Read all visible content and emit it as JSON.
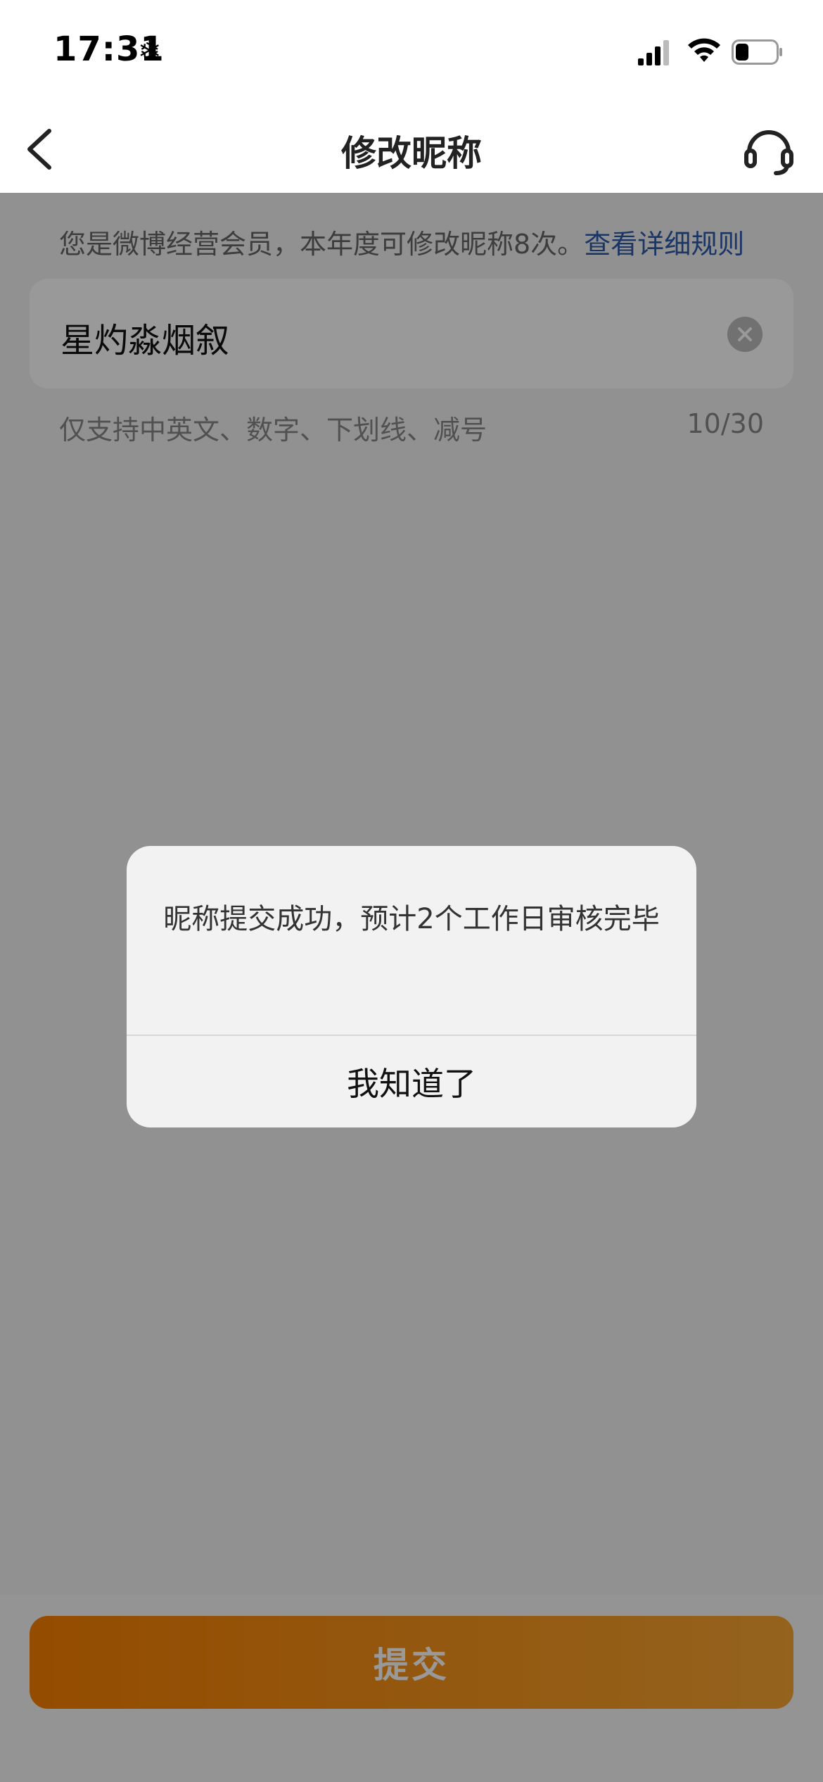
{
  "status_bar": {
    "time": "17:31",
    "snow_symbol": "❄"
  },
  "nav": {
    "title": "修改昵称",
    "back_icon": "chevron-left-icon",
    "support_icon": "headset-icon"
  },
  "info": {
    "text": "您是微博经营会员，本年度可修改昵称8次。",
    "link": "查看详细规则"
  },
  "name_input": {
    "value": "星灼淼烟叙",
    "clear_icon": "clear-circle-icon"
  },
  "hint": {
    "rule": "仅支持中英文、数字、下划线、减号",
    "counter": "10/30"
  },
  "submit": {
    "label": "提交"
  },
  "dialog": {
    "message": "昵称提交成功，预计2个工作日审核完毕",
    "button": "我知道了"
  },
  "colors": {
    "accent_start": "#f77f00",
    "accent_end": "#f7a532",
    "link": "#2e5aa8"
  }
}
